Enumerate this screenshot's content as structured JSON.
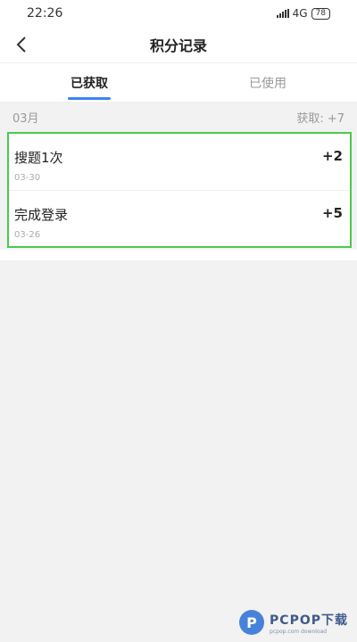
{
  "status_bar": {
    "time": "22:26",
    "network": "4G",
    "battery": "78"
  },
  "header": {
    "title": "积分记录"
  },
  "tabs": [
    {
      "label": "已获取",
      "active": true
    },
    {
      "label": "已使用",
      "active": false
    }
  ],
  "month_group": {
    "month": "03月",
    "summary": "获取: +7"
  },
  "records": [
    {
      "name": "搜题1次",
      "date": "03-30",
      "points": "+2"
    },
    {
      "name": "完成登录",
      "date": "03-26",
      "points": "+5"
    }
  ],
  "watermark": {
    "logo_letter": "P",
    "main": "PCPOP下载",
    "sub": "pcpop.com download"
  },
  "colors": {
    "accent": "#3b82f6",
    "highlight_border": "#4cc94c"
  }
}
